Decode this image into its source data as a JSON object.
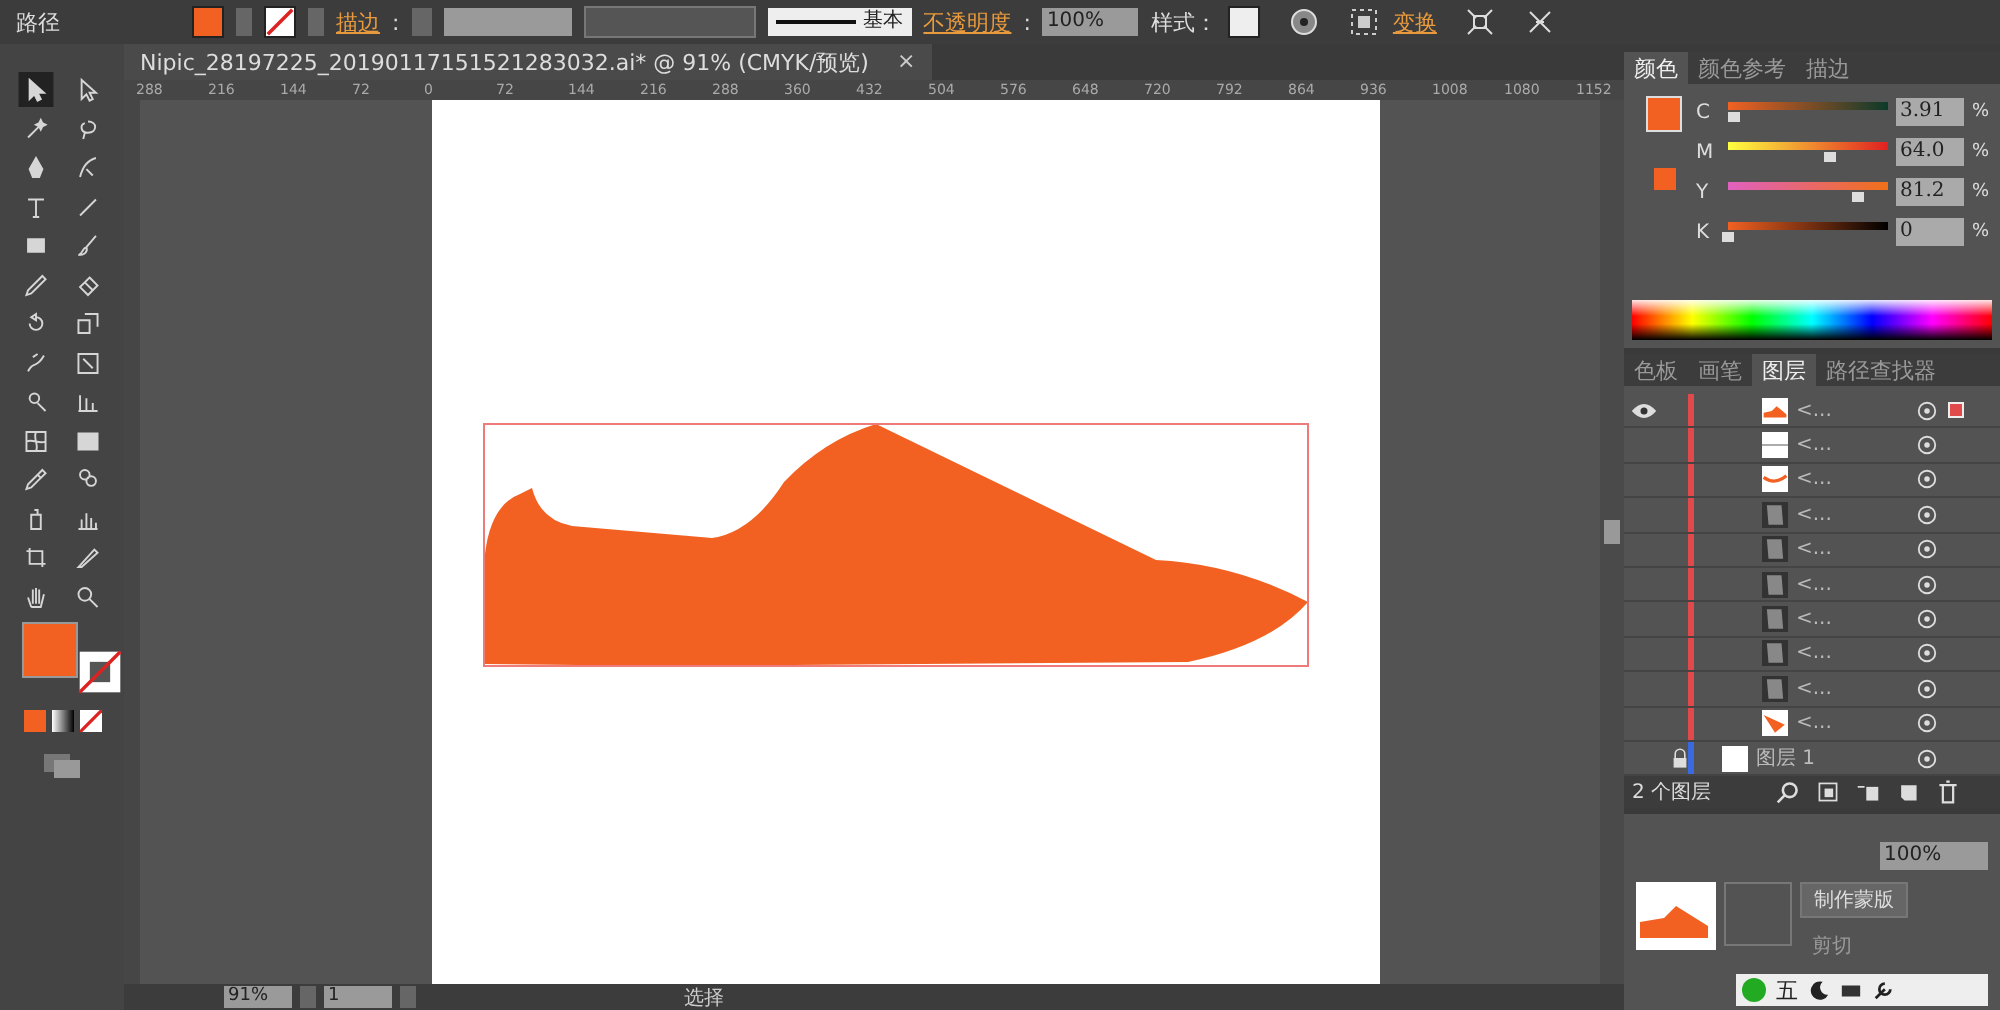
{
  "control_bar": {
    "selection_label": "路径",
    "stroke_link": "描边",
    "stroke_separator": ":",
    "stroke_style": "基本",
    "opacity_link": "不透明度",
    "opacity_separator": ":",
    "opacity_value": "100%",
    "style_label": "样式：",
    "transform_link": "变换"
  },
  "document_tab": {
    "title": "Nipic_28197225_20190117151521283032.ai* @ 91% (CMYK/预览)",
    "close": "×"
  },
  "ruler_marks": [
    "288",
    "216",
    "144",
    "72",
    "0",
    "72",
    "144",
    "216",
    "288",
    "360",
    "432",
    "504",
    "576",
    "648",
    "720",
    "792",
    "864",
    "936",
    "1008",
    "1080",
    "1152"
  ],
  "tools": [
    {
      "kind": "selection",
      "selected": true
    },
    {
      "kind": "direct-selection",
      "selected": false
    },
    {
      "kind": "magic-wand",
      "selected": false
    },
    {
      "kind": "lasso",
      "selected": false
    },
    {
      "kind": "pen",
      "selected": false
    },
    {
      "kind": "curvature",
      "selected": false
    },
    {
      "kind": "type",
      "selected": false
    },
    {
      "kind": "line",
      "selected": false
    },
    {
      "kind": "rectangle",
      "selected": false
    },
    {
      "kind": "paintbrush",
      "selected": false
    },
    {
      "kind": "pencil",
      "selected": false
    },
    {
      "kind": "eraser",
      "selected": false
    },
    {
      "kind": "rotate",
      "selected": false
    },
    {
      "kind": "scale",
      "selected": false
    },
    {
      "kind": "warp",
      "selected": false
    },
    {
      "kind": "free-transform",
      "selected": false
    },
    {
      "kind": "shape-builder",
      "selected": false
    },
    {
      "kind": "perspective",
      "selected": false
    },
    {
      "kind": "mesh",
      "selected": false
    },
    {
      "kind": "gradient",
      "selected": false
    },
    {
      "kind": "eyedropper",
      "selected": false
    },
    {
      "kind": "blend",
      "selected": false
    },
    {
      "kind": "symbol-sprayer",
      "selected": false
    },
    {
      "kind": "column-graph",
      "selected": false
    },
    {
      "kind": "artboard",
      "selected": false
    },
    {
      "kind": "slice",
      "selected": false
    },
    {
      "kind": "hand",
      "selected": false
    },
    {
      "kind": "zoom",
      "selected": false
    }
  ],
  "status_bar": {
    "zoom": "91%",
    "artboard": "1",
    "tool": "选择"
  },
  "color_panel": {
    "tabs": [
      {
        "label": "颜色",
        "selected": true
      },
      {
        "label": "颜色参考",
        "selected": false
      },
      {
        "label": "描边",
        "selected": false
      }
    ],
    "channels": [
      {
        "name": "C",
        "level": 0.04,
        "value": "3.91",
        "unit": "%"
      },
      {
        "name": "M",
        "level": 0.64,
        "value": "64.0",
        "unit": "%"
      },
      {
        "name": "Y",
        "level": 0.81,
        "value": "81.2",
        "unit": "%"
      },
      {
        "name": "K",
        "level": 0,
        "value": "0",
        "unit": "%"
      }
    ]
  },
  "layers_panel": {
    "tabs": [
      {
        "label": "色板",
        "selected": false
      },
      {
        "label": "画笔",
        "selected": false
      },
      {
        "label": "图层",
        "selected": true
      },
      {
        "label": "路径查找器",
        "selected": false
      }
    ],
    "rows": [
      {
        "name": "<...",
        "kind": "shoe",
        "visible": true,
        "selected": true
      },
      {
        "name": "<...",
        "kind": "light",
        "visible": false,
        "selected": false
      },
      {
        "name": "<...",
        "kind": "curve",
        "visible": false,
        "selected": false
      },
      {
        "name": "<...",
        "kind": "dark",
        "visible": false,
        "selected": false
      },
      {
        "name": "<...",
        "kind": "dark",
        "visible": false,
        "selected": false
      },
      {
        "name": "<...",
        "kind": "dark",
        "visible": false,
        "selected": false
      },
      {
        "name": "<...",
        "kind": "dark",
        "visible": false,
        "selected": false
      },
      {
        "name": "<...",
        "kind": "dark",
        "visible": false,
        "selected": false
      },
      {
        "name": "<...",
        "kind": "dark",
        "visible": false,
        "selected": false
      },
      {
        "name": "<...",
        "kind": "sole",
        "visible": false,
        "selected": false
      }
    ],
    "layer": {
      "name": "图层 1",
      "locked": true
    },
    "count": "2 个图层"
  },
  "transparency_panel": {
    "opacity": "100%",
    "make_mask": "制作蒙版",
    "clip": "剪切"
  },
  "ime_bar": {
    "mode": "五"
  }
}
